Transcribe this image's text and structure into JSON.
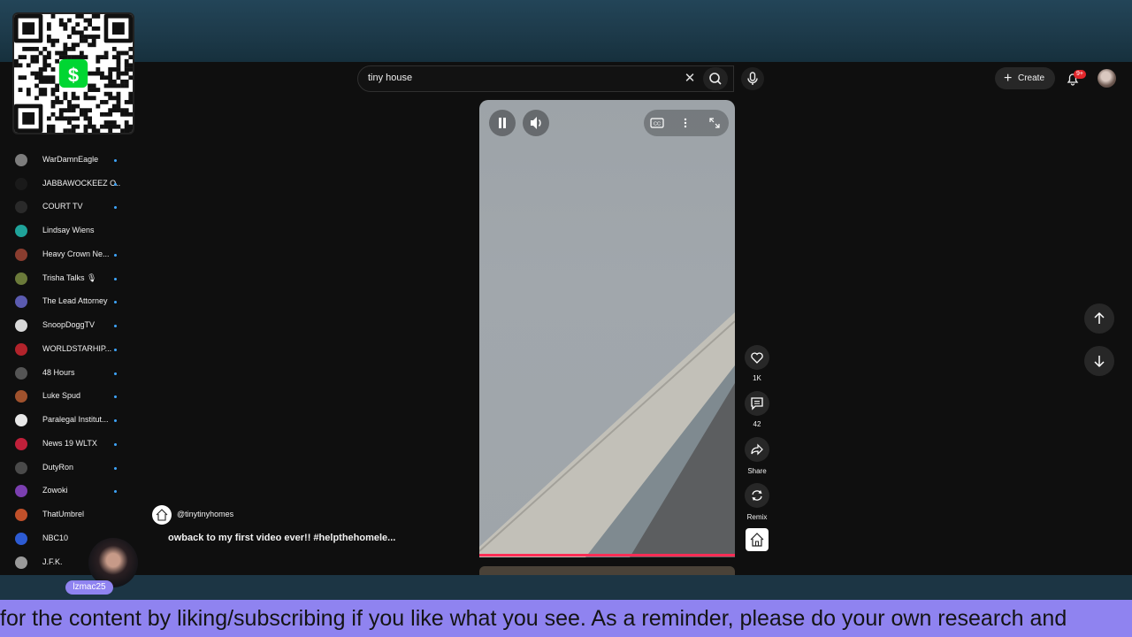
{
  "search": {
    "query": "tiny house",
    "clear_icon": "close-icon",
    "search_icon": "search-icon",
    "mic_icon": "mic-icon"
  },
  "header": {
    "create_label": "Create",
    "notification_badge": "9+"
  },
  "sidebar": {
    "items": [
      {
        "label": "WarDamnEagle",
        "color": "#7d7d7d"
      },
      {
        "label": "JABBAWOCKEEZ O...",
        "color": "#1a1a1a"
      },
      {
        "label": "COURT TV",
        "color": "#2a2a2a"
      },
      {
        "label": "Lindsay Wiens",
        "color": "#1fa39a"
      },
      {
        "label": "Heavy Crown Ne...",
        "color": "#8a3d2f"
      },
      {
        "label": "Trisha Talks 🎙",
        "color": "#6b7a3a"
      },
      {
        "label": "The Lead Attorney",
        "color": "#5b5bb0"
      },
      {
        "label": "SnoopDoggTV",
        "color": "#d9d9d9"
      },
      {
        "label": "WORLDSTARHIP...",
        "color": "#b2232b"
      },
      {
        "label": "48 Hours",
        "color": "#555555"
      },
      {
        "label": "Luke Spud",
        "color": "#a0522d"
      },
      {
        "label": "Paralegal Institut...",
        "color": "#e8e8e8"
      },
      {
        "label": "News 19 WLTX",
        "color": "#c0203a"
      },
      {
        "label": "DutyRon",
        "color": "#4a4a4a"
      },
      {
        "label": "Zowoki",
        "color": "#7b3fb0"
      },
      {
        "label": "ThatUmbrel",
        "color": "#c0502a"
      },
      {
        "label": "NBC10",
        "color": "#2d5bd3"
      },
      {
        "label": "J.F.K.",
        "color": "#9a9a9a"
      }
    ]
  },
  "video": {
    "channel_handle": "@tinytinyhomes",
    "caption": "owback to my first video ever!! #helpthehomele..."
  },
  "actions": {
    "like_count": "1K",
    "comment_count": "42",
    "share_label": "Share",
    "remix_label": "Remix"
  },
  "overlay": {
    "ticker_text": "for the content by liking/subscribing if you like what you see. As a reminder, please do your own research and",
    "streamer_name": "lzmac25",
    "qr_color": "#00d632"
  }
}
